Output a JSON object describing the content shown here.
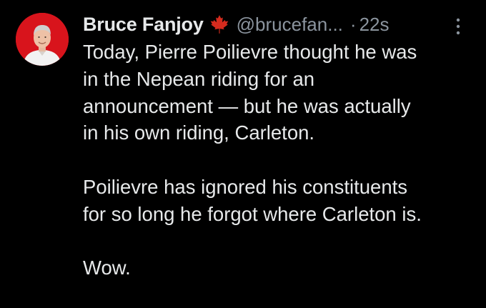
{
  "tweet": {
    "author": {
      "display_name": "Bruce Fanjoy",
      "badge_icon": "maple-leaf-icon",
      "handle": "@brucefan...",
      "time_separator": "·",
      "time_ago": "22s",
      "avatar_bg": "#d8141c"
    },
    "more_icon": "vertical-ellipsis-icon",
    "body": {
      "paragraph_1": [
        "Today, Pierre Poilievre thought he was",
        "in the Nepean riding for an",
        "announcement — but he was actually",
        "in his own riding, Carleton."
      ],
      "paragraph_2": [
        "Poilievre has ignored his constituents",
        "for so long he forgot where Carleton is."
      ],
      "paragraph_3": [
        "Wow."
      ]
    }
  },
  "colors": {
    "background": "#000000",
    "text_primary": "#e7e9ea",
    "text_secondary": "#8b949e",
    "maple_leaf": "#d52b1e"
  }
}
